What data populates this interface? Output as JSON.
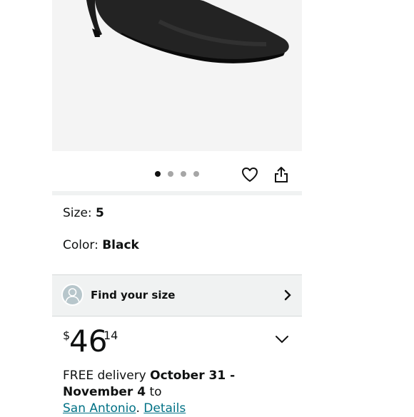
{
  "carousel": {
    "dot_count": 4,
    "active_index": 0,
    "icons": [
      "heart-icon",
      "share-icon"
    ]
  },
  "product": {
    "size_label": "Size: ",
    "size_value": "5",
    "color_label": "Color: ",
    "color_value": "Black"
  },
  "find_size": {
    "label": "Find your size",
    "icons": [
      "avatar-icon",
      "chevron-right-icon"
    ]
  },
  "price": {
    "symbol": "$",
    "whole": "46",
    "fraction": "14"
  },
  "delivery": {
    "prefix": "FREE delivery ",
    "dates": "October 31 - November 4",
    "to": " to",
    "location": "San Antonio",
    "separator": ". ",
    "details_link": "Details"
  },
  "colors": {
    "link": "#007185",
    "panel_bg": "#f0f2f2",
    "image_bg": "#f4f4f4"
  }
}
